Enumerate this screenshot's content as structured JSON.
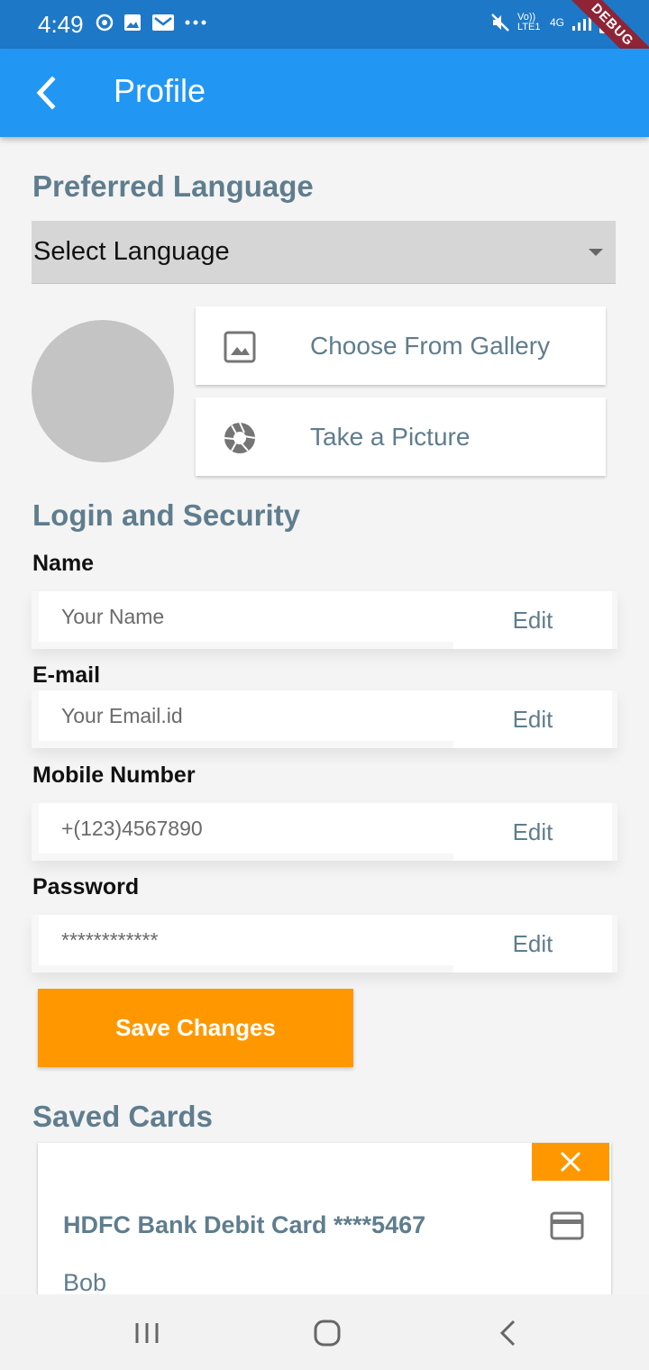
{
  "status_bar": {
    "time": "4:49",
    "left_icons": [
      "vpn-icon",
      "gallery-notification-icon",
      "mail-notification-icon",
      "more-notifications-icon"
    ],
    "right_icons": [
      "mute-icon",
      "volte-icon",
      "4g-icon",
      "signal-icon",
      "battery-icon"
    ],
    "volte_text": "Vo)) LTE1",
    "network_text": "4G",
    "debug_label": "DEBUG"
  },
  "app_bar": {
    "title": "Profile"
  },
  "preferred_language": {
    "title": "Preferred Language",
    "select_value": "Select Language"
  },
  "photo_options": {
    "gallery_label": "Choose From Gallery",
    "camera_label": "Take a Picture"
  },
  "login_security": {
    "title": "Login and Security",
    "fields": [
      {
        "label": "Name",
        "placeholder": "Your Name",
        "value": "",
        "edit": "Edit"
      },
      {
        "label": "E-mail",
        "placeholder": "Your Email.id",
        "value": "",
        "edit": "Edit"
      },
      {
        "label": "Mobile Number",
        "placeholder": "+(123)4567890",
        "value": "",
        "edit": "Edit"
      },
      {
        "label": "Password",
        "placeholder": "************",
        "value": "",
        "edit": "Edit"
      }
    ],
    "save_label": "Save Changes"
  },
  "saved_cards": {
    "title": "Saved Cards",
    "cards": [
      {
        "name": "HDFC Bank Debit Card ****5467",
        "holder": "Bob"
      }
    ]
  },
  "colors": {
    "status_bar": "#1e78c8",
    "app_bar": "#2196f3",
    "accent": "#ff9800",
    "section_text": "#5f7d8e",
    "debug_ribbon": "#8e2436"
  }
}
